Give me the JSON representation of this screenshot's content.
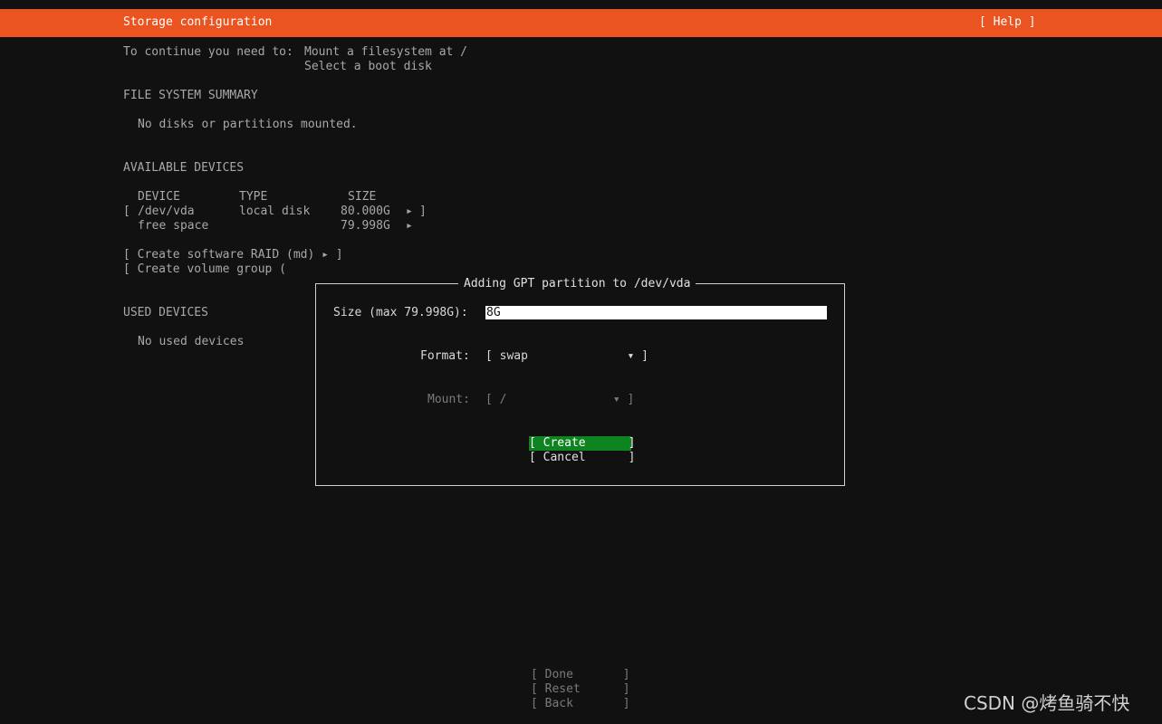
{
  "header": {
    "title": "Storage configuration",
    "help": "[ Help ]",
    "bg_color": "#e95420"
  },
  "requirements": {
    "prefix": "To continue you need to:",
    "items": [
      "Mount a filesystem at /",
      "Select a boot disk"
    ]
  },
  "fs_summary": {
    "heading": "FILE SYSTEM SUMMARY",
    "empty": "No disks or partitions mounted."
  },
  "available": {
    "heading": "AVAILABLE DEVICES",
    "columns": [
      "DEVICE",
      "TYPE",
      "SIZE"
    ],
    "rows": [
      {
        "open": "[",
        "device": "/dev/vda",
        "type": "local disk",
        "size": "80.000G",
        "arrow": "▸",
        "close": "]"
      },
      {
        "open": "",
        "device": "free space",
        "type": "",
        "size": "79.998G",
        "arrow": "▸",
        "close": ""
      }
    ],
    "create_raid": "[ Create software RAID (md) ▸ ]",
    "create_vg": "[ Create volume group ("
  },
  "used": {
    "heading": "USED DEVICES",
    "empty": "No used devices"
  },
  "dialog": {
    "title": "Adding GPT partition to /dev/vda",
    "size_label": "Size (max 79.998G):",
    "size_value": "8G",
    "format_label": "Format:",
    "format_value": "[ swap              ▾ ]",
    "mount_label": "Mount:",
    "mount_value": "[ /               ▾ ]",
    "create_label": "[ Create      ]",
    "cancel_label": "[ Cancel      ]",
    "create_color": "#0e8420"
  },
  "footer": {
    "done": "[ Done       ]",
    "reset": "[ Reset      ]",
    "back": "[ Back       ]"
  },
  "watermark": "CSDN @烤鱼骑不快"
}
